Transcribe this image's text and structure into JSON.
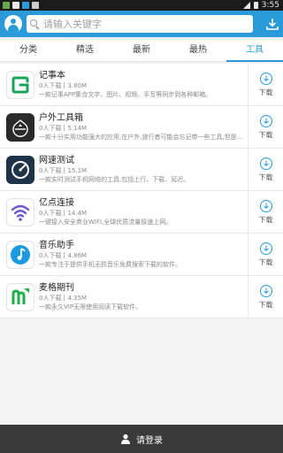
{
  "status_bar": {
    "time": "3:55"
  },
  "header": {
    "search_placeholder": "请输入关键字"
  },
  "tabs": [
    {
      "label": "分类",
      "active": false
    },
    {
      "label": "精选",
      "active": false
    },
    {
      "label": "最新",
      "active": false
    },
    {
      "label": "最热",
      "active": false
    },
    {
      "label": "工具",
      "active": true
    }
  ],
  "apps": [
    {
      "name": "记事本",
      "downloads": "0人下载",
      "size": "3.80M",
      "desc": "一款记事APP集合文字、图片、视频、手写等同步到各种邮箱。",
      "download_label": "下载",
      "icon": "notepad-icon",
      "icon_color": "#1aa35a"
    },
    {
      "name": "户外工具箱",
      "downloads": "0人下载",
      "size": "5.14M",
      "desc": "一款十分实用功能强大的应用,在户外,旅行者可能会忘记带一些工具,但是...",
      "download_label": "下载",
      "icon": "outdoor-toolbox-icon",
      "icon_color": "#2a2a2a"
    },
    {
      "name": "网速测试",
      "downloads": "0人下载",
      "size": "15.1M",
      "desc": "一款实时测试手机网络的工具,包括上行、下载、延迟。",
      "download_label": "下载",
      "icon": "speedometer-icon",
      "icon_color": "#1f3348"
    },
    {
      "name": "亿点连接",
      "downloads": "0人下载",
      "size": "14.4M",
      "desc": "一键接入安全商业WIFI,全球优质流量极速上网。",
      "download_label": "下载",
      "icon": "wifi-icon",
      "icon_color": "#6b55c9"
    },
    {
      "name": "音乐助手",
      "downloads": "0人下载",
      "size": "4.86M",
      "desc": "一款专注于提供手机无损音乐免费搜索下载的软件。",
      "download_label": "下载",
      "icon": "music-note-icon",
      "icon_color": "#1d9ae0"
    },
    {
      "name": "麦格期刊",
      "downloads": "0人下载",
      "size": "4.35M",
      "desc": "一款永久VIP无限使用阅读下载软件。",
      "download_label": "下载",
      "icon": "magazine-icon",
      "icon_color": "#1fae4a"
    }
  ],
  "bottom_bar": {
    "login_label": "请登录"
  }
}
